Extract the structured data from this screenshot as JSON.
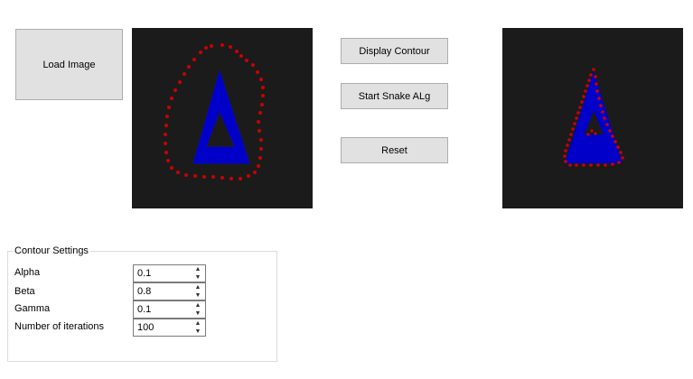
{
  "buttons": {
    "load_image": "Load Image",
    "display_contour": "Display Contour",
    "start_snake": "Start Snake ALg",
    "reset": "Reset"
  },
  "settings": {
    "title": "Contour Settings",
    "fields": [
      {
        "label": "Alpha",
        "value": "0.1"
      },
      {
        "label": "Beta",
        "value": "0.8"
      },
      {
        "label": "Gamma",
        "value": "0.1"
      },
      {
        "label": "Number of iterations",
        "value": "100"
      }
    ]
  },
  "colors": {
    "canvas_bg": "#1b1b1b",
    "shape_fill": "#0000c8",
    "contour_points": "#cc0000"
  },
  "icons": {
    "spin_up": "chevron-up-icon",
    "spin_down": "chevron-down-icon"
  }
}
